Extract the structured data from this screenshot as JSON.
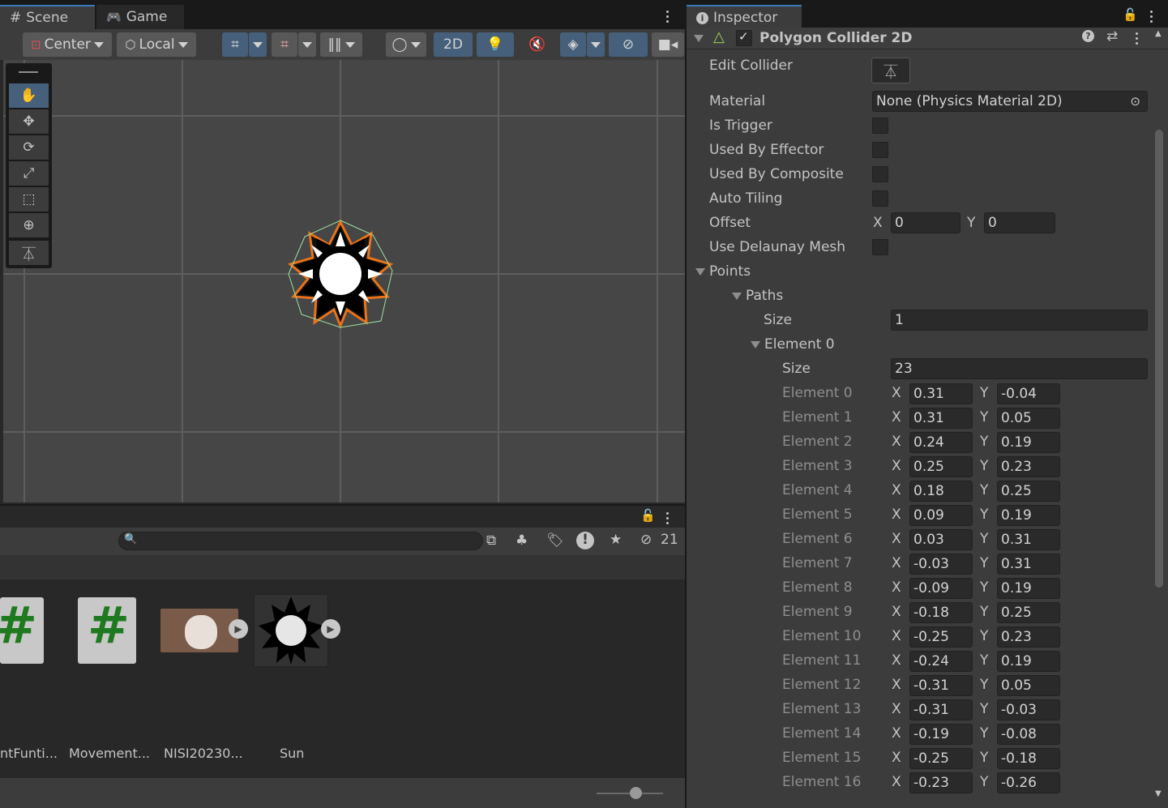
{
  "scene_tabs": {
    "scene": "Scene",
    "game": "Game"
  },
  "scene_toolbar": {
    "pivot": "Center",
    "space": "Local",
    "mode_2d": "2D"
  },
  "project": {
    "hidden_count": "21",
    "assets": [
      {
        "label": "ntFunti..."
      },
      {
        "label": "Movement..."
      },
      {
        "label": "NISI20230..."
      },
      {
        "label": "Sun"
      }
    ]
  },
  "inspector": {
    "tab": "Inspector",
    "component": "Polygon Collider 2D",
    "props": {
      "edit_collider": "Edit Collider",
      "material": "Material",
      "material_value": "None (Physics Material 2D)",
      "is_trigger": "Is Trigger",
      "used_by_effector": "Used By Effector",
      "used_by_composite": "Used By Composite",
      "auto_tiling": "Auto Tiling",
      "offset": "Offset",
      "offset_x": "0",
      "offset_y": "0",
      "use_delaunay": "Use Delaunay Mesh",
      "points": "Points",
      "paths": "Paths",
      "size_label": "Size",
      "paths_size": "1",
      "element0": "Element 0",
      "element0_size": "23",
      "x_label": "X",
      "y_label": "Y"
    },
    "elements": [
      {
        "label": "Element 0",
        "x": "0.31",
        "y": "-0.04"
      },
      {
        "label": "Element 1",
        "x": "0.31",
        "y": "0.05"
      },
      {
        "label": "Element 2",
        "x": "0.24",
        "y": "0.19"
      },
      {
        "label": "Element 3",
        "x": "0.25",
        "y": "0.23"
      },
      {
        "label": "Element 4",
        "x": "0.18",
        "y": "0.25"
      },
      {
        "label": "Element 5",
        "x": "0.09",
        "y": "0.19"
      },
      {
        "label": "Element 6",
        "x": "0.03",
        "y": "0.31"
      },
      {
        "label": "Element 7",
        "x": "-0.03",
        "y": "0.31"
      },
      {
        "label": "Element 8",
        "x": "-0.09",
        "y": "0.19"
      },
      {
        "label": "Element 9",
        "x": "-0.18",
        "y": "0.25"
      },
      {
        "label": "Element 10",
        "x": "-0.25",
        "y": "0.23"
      },
      {
        "label": "Element 11",
        "x": "-0.24",
        "y": "0.19"
      },
      {
        "label": "Element 12",
        "x": "-0.31",
        "y": "0.05"
      },
      {
        "label": "Element 13",
        "x": "-0.31",
        "y": "-0.03"
      },
      {
        "label": "Element 14",
        "x": "-0.19",
        "y": "-0.08"
      },
      {
        "label": "Element 15",
        "x": "-0.25",
        "y": "-0.18"
      },
      {
        "label": "Element 16",
        "x": "-0.23",
        "y": "-0.26"
      }
    ]
  },
  "colors": {
    "accent": "#3a79bb",
    "collider_outline": "#e8731a",
    "collider_green": "#9ee0a0",
    "script_green": "#1f7a1f"
  }
}
